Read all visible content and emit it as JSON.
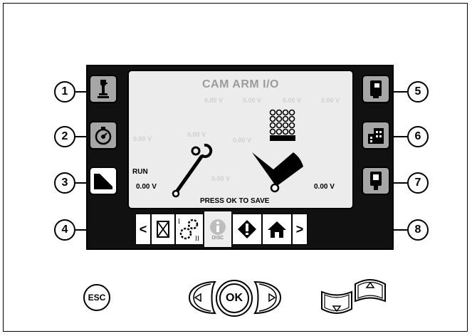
{
  "screen": {
    "title": "CAM ARM I/O",
    "prompt": "PRESS OK TO SAVE",
    "run_label": "RUN",
    "left_value": "0.00 V",
    "right_value": "0.00 V",
    "info_caption": "DISC",
    "ghost_values": [
      "0.00 V",
      "0.00 V",
      "0.00 V",
      "0.00 V",
      "0.00 V",
      "0.00 V",
      "0.00 V",
      "0.00 V"
    ]
  },
  "callouts": [
    "1",
    "2",
    "3",
    "4",
    "5",
    "6",
    "7",
    "8"
  ],
  "side_buttons_left": [
    {
      "icon": "joystick-icon",
      "active": false
    },
    {
      "icon": "stopwatch-icon",
      "active": false
    },
    {
      "icon": "cam-arm-icon",
      "active": true
    }
  ],
  "side_buttons_right": [
    {
      "icon": "controller-icon"
    },
    {
      "icon": "building-icon"
    },
    {
      "icon": "handheld-icon"
    }
  ],
  "bottom_bar": {
    "prev": "<",
    "next": ">",
    "icons": [
      "hourglass-icon",
      "io-gears-icon",
      "info-icon",
      "warning-icon",
      "home-icon"
    ]
  },
  "keys": {
    "esc": "ESC",
    "ok": "OK"
  },
  "colors": {
    "screen_bg": "#111111",
    "panel_bg": "#ececec",
    "button_grey": "#a6a6a6"
  }
}
